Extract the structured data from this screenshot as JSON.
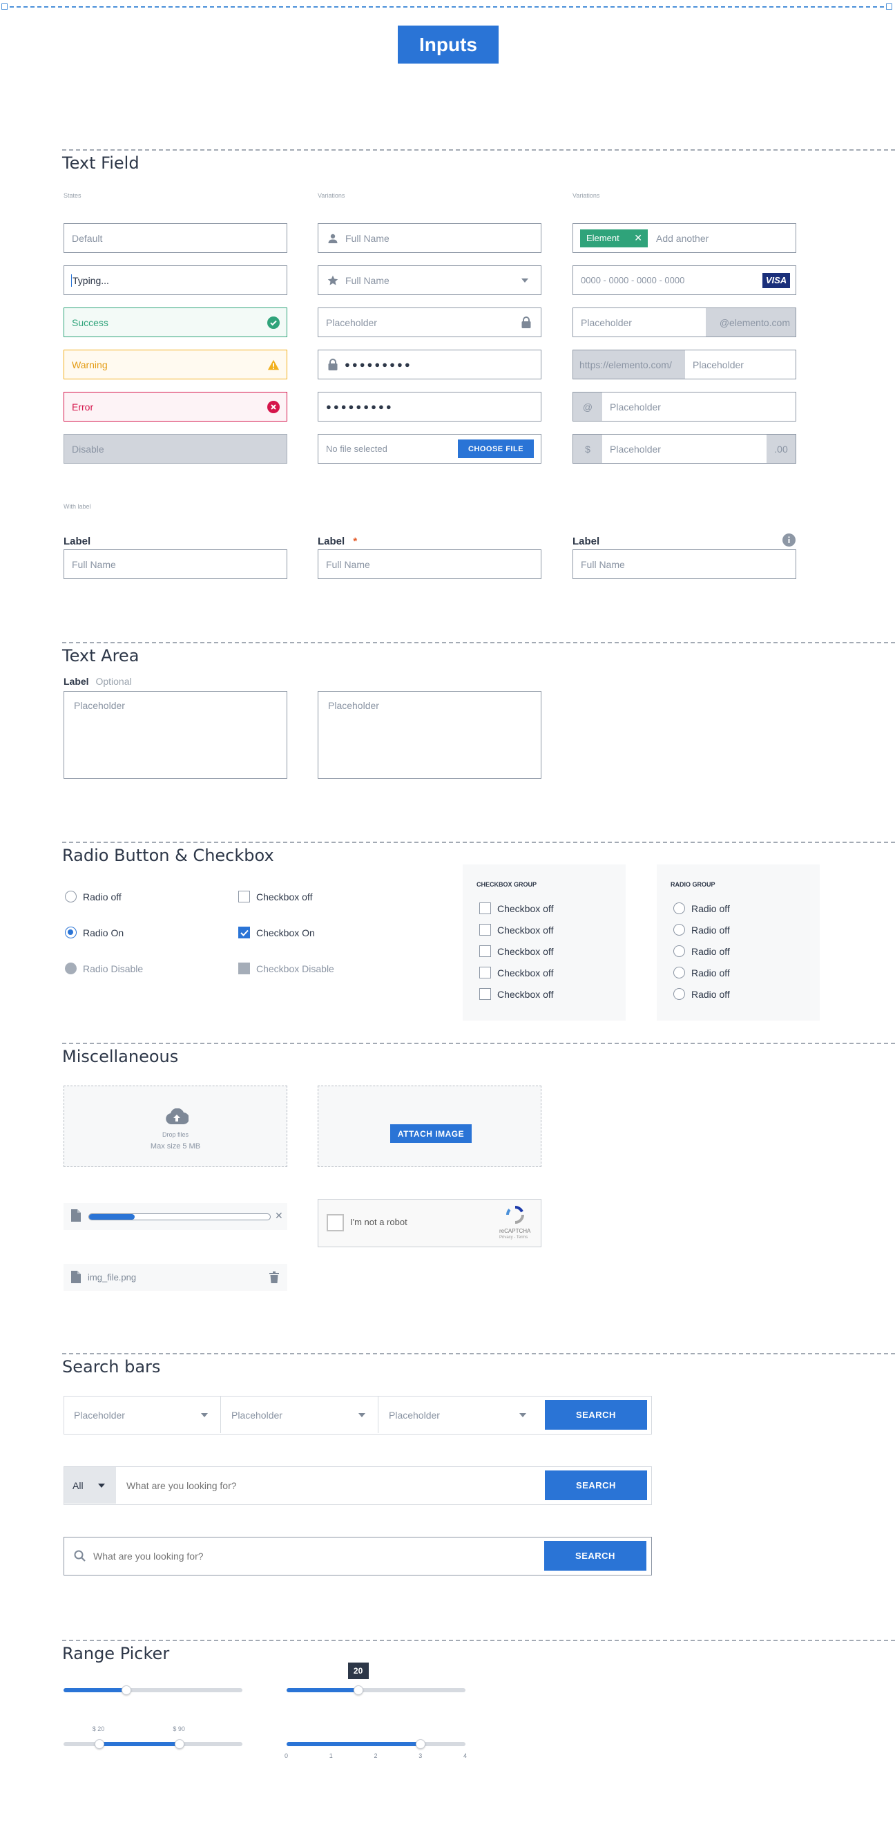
{
  "header": {
    "title": "Inputs"
  },
  "text_field": {
    "title": "Text Field",
    "col1_label": "States",
    "col2_label": "Variations",
    "col3_label": "Variations",
    "states": {
      "default": "Default",
      "typing": "Typing...",
      "success": "Success",
      "warning": "Warning",
      "error": "Error",
      "disable": "Disable"
    },
    "variations": {
      "full_name_1": "Full Name",
      "full_name_2": "Full Name",
      "placeholder_lock": "Placeholder",
      "password_1": "●●●●●●●●●",
      "password_2": "●●●●●●●●●",
      "file_none": "No file selected",
      "choose_file": "CHOOSE FILE"
    },
    "variations2": {
      "tag": "Element",
      "add_another": "Add another",
      "card_number": "0000 - 0000 - 0000 - 0000",
      "card_brand": "VISA",
      "placeholder_suffix": "Placeholder",
      "suffix": "@elemento.com",
      "prefix_url": "https://elemento.com/",
      "placeholder_prefix": "Placeholder",
      "at_prefix": "@",
      "placeholder_at": "Placeholder",
      "dollar": "$",
      "placeholder_dollar": "Placeholder",
      "cents": ".00"
    },
    "with_label": {
      "heading": "With label",
      "label1": "Label",
      "label2": "Label",
      "required_mark": "*",
      "label3": "Label",
      "placeholder1": "Full Name",
      "placeholder2": "Full Name",
      "placeholder3": "Full Name"
    }
  },
  "text_area": {
    "title": "Text Area",
    "label": "Label",
    "optional": "Optional",
    "placeholder1": "Placeholder",
    "placeholder2": "Placeholder"
  },
  "radio_checkbox": {
    "title": "Radio Button & Checkbox",
    "radio_off": "Radio off",
    "radio_on": "Radio On",
    "radio_disable": "Radio Disable",
    "checkbox_off": "Checkbox off",
    "checkbox_on": "Checkbox On",
    "checkbox_disable": "Checkbox Disable",
    "checkbox_group_title": "CHECKBOX GROUP",
    "checkbox_group": [
      "Checkbox off",
      "Checkbox off",
      "Checkbox off",
      "Checkbox off",
      "Checkbox off"
    ],
    "radio_group_title": "RADIO GROUP",
    "radio_group": [
      "Radio off",
      "Radio off",
      "Radio off",
      "Radio off",
      "Radio off"
    ]
  },
  "misc": {
    "title": "Miscellaneous",
    "drop_files": "Drop files",
    "max_size": "Max size 5 MB",
    "attach_image": "ATTACH IMAGE",
    "upload_progress": 0.25,
    "captcha_text": "I'm not a robot",
    "captcha_brand": "reCAPTCHA",
    "captcha_links": "Privacy - Terms",
    "file_name": "img_file.png"
  },
  "search_bars": {
    "title": "Search bars",
    "dropdowns": [
      "Placeholder",
      "Placeholder",
      "Placeholder"
    ],
    "search_label_1": "SEARCH",
    "category": "All",
    "query_placeholder_2": "What are you looking for?",
    "search_label_2": "SEARCH",
    "query_placeholder_3": "What are you looking for?",
    "search_label_3": "SEARCH"
  },
  "range_picker": {
    "title": "Range Picker",
    "slider1_value": 0.35,
    "slider2_value": 0.4,
    "slider2_tooltip": "20",
    "range_low_label": "$ 20",
    "range_high_label": "$ 90",
    "range_low": 0.2,
    "range_high": 0.65,
    "step_value": 3,
    "step_labels": [
      "0",
      "1",
      "2",
      "3",
      "4"
    ]
  },
  "colors": {
    "primary": "#2a74d6",
    "success": "#2fa37a",
    "warning": "#f2b01e",
    "error": "#d5154b",
    "disabled": "#d1d5dc"
  }
}
